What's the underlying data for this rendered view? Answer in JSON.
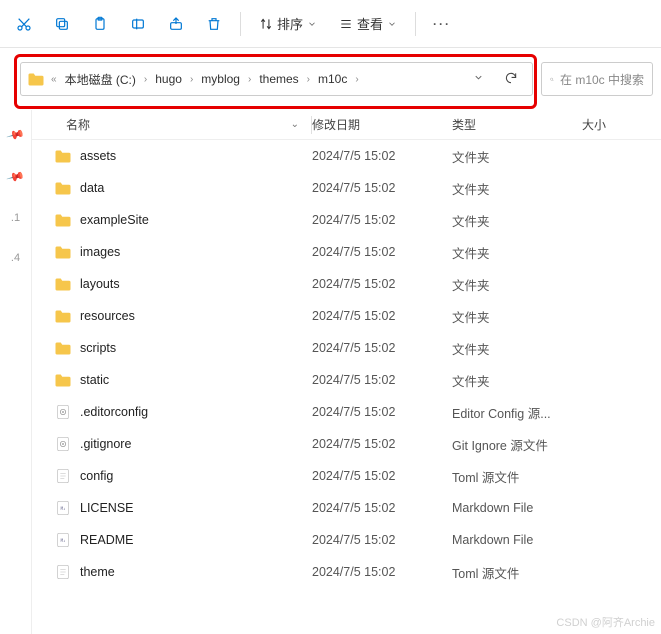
{
  "toolbar": {
    "sort_label": "排序",
    "view_label": "查看"
  },
  "path": {
    "drive": "本地磁盘 (C:)",
    "segments": [
      "hugo",
      "myblog",
      "themes",
      "m10c"
    ]
  },
  "search": {
    "placeholder": "在 m10c 中搜索"
  },
  "columns": {
    "name": "名称",
    "date": "修改日期",
    "type": "类型",
    "size": "大小"
  },
  "sidebar": {
    "items": [
      ".1",
      ".4"
    ]
  },
  "rows": [
    {
      "icon": "folder",
      "name": "assets",
      "date": "2024/7/5 15:02",
      "type": "文件夹"
    },
    {
      "icon": "folder",
      "name": "data",
      "date": "2024/7/5 15:02",
      "type": "文件夹"
    },
    {
      "icon": "folder",
      "name": "exampleSite",
      "date": "2024/7/5 15:02",
      "type": "文件夹"
    },
    {
      "icon": "folder",
      "name": "images",
      "date": "2024/7/5 15:02",
      "type": "文件夹"
    },
    {
      "icon": "folder",
      "name": "layouts",
      "date": "2024/7/5 15:02",
      "type": "文件夹"
    },
    {
      "icon": "folder",
      "name": "resources",
      "date": "2024/7/5 15:02",
      "type": "文件夹"
    },
    {
      "icon": "folder",
      "name": "scripts",
      "date": "2024/7/5 15:02",
      "type": "文件夹"
    },
    {
      "icon": "folder",
      "name": "static",
      "date": "2024/7/5 15:02",
      "type": "文件夹"
    },
    {
      "icon": "gear",
      "name": ".editorconfig",
      "date": "2024/7/5 15:02",
      "type": "Editor Config 源..."
    },
    {
      "icon": "gear",
      "name": ".gitignore",
      "date": "2024/7/5 15:02",
      "type": "Git Ignore 源文件"
    },
    {
      "icon": "file",
      "name": "config",
      "date": "2024/7/5 15:02",
      "type": "Toml 源文件"
    },
    {
      "icon": "md",
      "name": "LICENSE",
      "date": "2024/7/5 15:02",
      "type": "Markdown File"
    },
    {
      "icon": "md",
      "name": "README",
      "date": "2024/7/5 15:02",
      "type": "Markdown File"
    },
    {
      "icon": "file",
      "name": "theme",
      "date": "2024/7/5 15:02",
      "type": "Toml 源文件"
    }
  ],
  "watermark": "CSDN @阿齐Archie"
}
